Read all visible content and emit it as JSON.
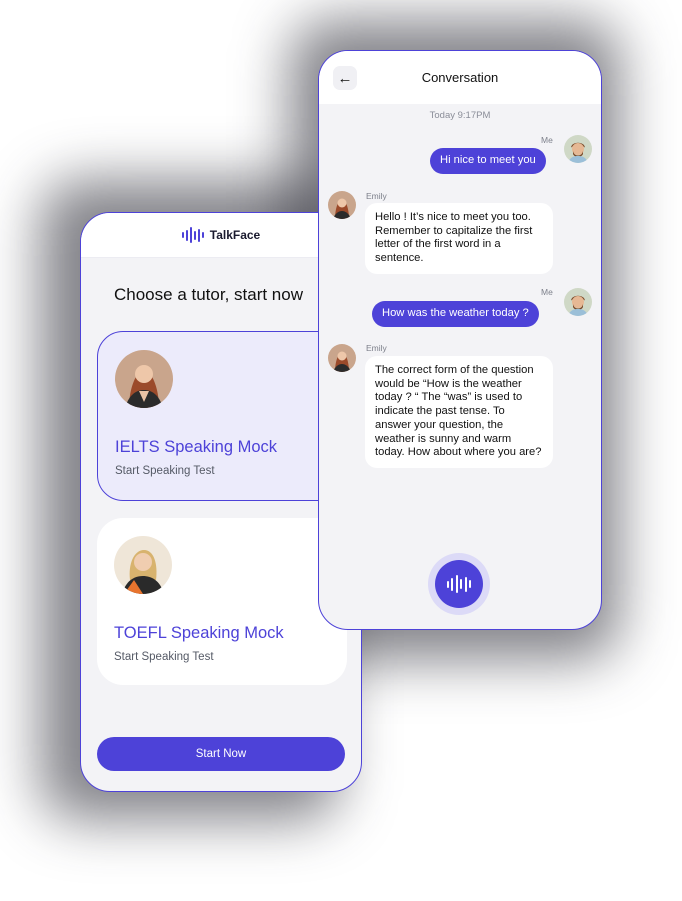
{
  "left_phone": {
    "brand": "TalkFace",
    "heading": "Choose a tutor, start now",
    "tutors": [
      {
        "name": "IELTS Speaking Mock",
        "subtitle": "Start Speaking Test",
        "selected": true
      },
      {
        "name": "TOEFL Speaking Mock",
        "subtitle": "Start Speaking Test",
        "selected": false
      }
    ],
    "start_button": "Start Now"
  },
  "right_phone": {
    "title": "Conversation",
    "timestamp": "Today 9:17PM",
    "messages": [
      {
        "sender": "Me",
        "text": "Hi nice to meet you"
      },
      {
        "sender": "Emily",
        "text": "Hello ! It’s nice to meet you too. Remember to capitalize the first letter of the first word in a sentence."
      },
      {
        "sender": "Me",
        "text": "How was the weather today ?"
      },
      {
        "sender": "Emily",
        "text": "The correct form of the question would be “How is the weather today ? “ The “was” is used to indicate the past tense. To answer your question, the weather is sunny and  warm today. How about where you are?"
      }
    ]
  },
  "icons": {
    "back": "arrow-left-icon",
    "brand_logo": "soundwave-logo-icon",
    "mic": "soundwave-mic-icon"
  },
  "colors": {
    "accent": "#4d42d8",
    "selected_card_bg": "#ecebfb",
    "app_bg": "#f3f3f6",
    "bubble_other_bg": "#ffffff"
  }
}
